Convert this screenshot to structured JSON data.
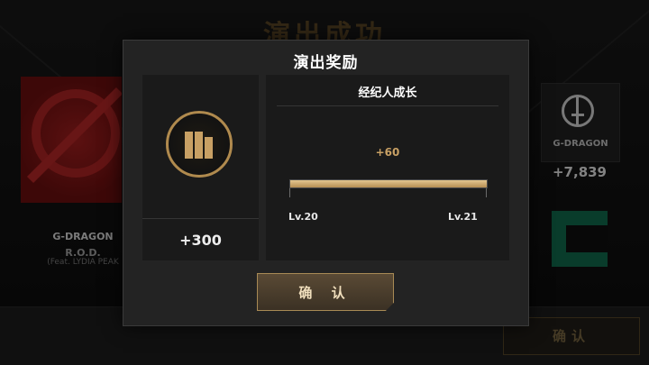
{
  "background": {
    "title": "演出成功",
    "song": {
      "artist": "G-DRAGON",
      "title": "R.O.D.",
      "feat": "(Feat. LYDIA PEAK"
    },
    "artist_badge_label": "G-DRAGON",
    "score": "+7,839",
    "confirm_label": "确认"
  },
  "modal": {
    "title": "演出奖励",
    "currency": {
      "icon": "record-coin-icon",
      "value": "+300"
    },
    "growth": {
      "title": "经纪人成长",
      "gain": "+60",
      "progress_fraction": 1.0,
      "level_from": "Lv.20",
      "level_to": "Lv.21"
    },
    "confirm_label": "确 认"
  },
  "colors": {
    "accent_gold": "#c8a064",
    "panel_bg": "#1a1a1a",
    "modal_bg": "#232323"
  }
}
